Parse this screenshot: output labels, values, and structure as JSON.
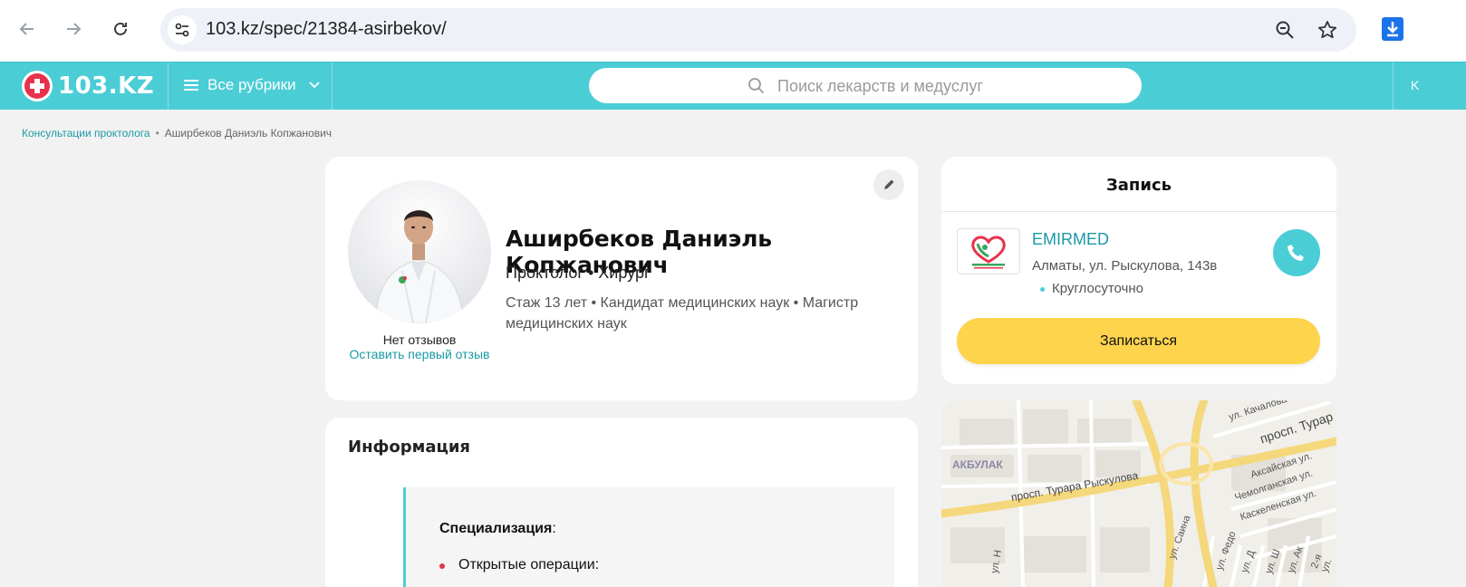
{
  "browser": {
    "url": "103.kz/spec/21384-asirbekov/",
    "icons": [
      "back-arrow-icon",
      "forward-arrow-icon",
      "reload-icon",
      "site-settings-icon",
      "zoom-icon",
      "bookmark-star-icon",
      "download-icon"
    ]
  },
  "header": {
    "logo_text": "103.KZ",
    "rubrics_label": "Все рубрики",
    "search_placeholder": "Поиск лекарств и медуслуг",
    "right_text": "K",
    "accent_color": "#4bcdd6"
  },
  "breadcrumb": {
    "items": [
      "Консультации проктолога",
      "Аширбеков Даниэль Копжанович"
    ],
    "separator": "•"
  },
  "profile": {
    "name": "Аширбеков Даниэль Копжанович",
    "specialties": "Проктолог • Хирург",
    "meta": "Стаж 13 лет  •  Кандидат медицинских наук • Магистр медицинских наук",
    "no_reviews": "Нет отзывов",
    "first_review_link": "Оставить первый отзыв"
  },
  "info": {
    "title": "Информация",
    "specialization_label": "Специализация",
    "specialization_colon": ":",
    "first_item": "Открытые операции:"
  },
  "booking": {
    "title": "Запись",
    "clinic_name": "EMIRMED",
    "clinic_address": "Алматы, ул. Рыскулова, 143в",
    "clinic_hours": "Круглосуточно",
    "book_button": "Записаться",
    "button_color": "#fdd44c"
  },
  "map": {
    "labels": {
      "kachalova": "ул. Качалова",
      "turar": "просп. Турар",
      "akbulak": "АКБУЛАК",
      "aksai": "Аксайская ул.",
      "turar_ryskulova": "просп. Турара Рыскулова",
      "chemolgan": "Чемолганская ул.",
      "kaskelen": "Каскеленская ул.",
      "saina": "ул. Саина",
      "fed": "ул. Федо",
      "ul1": "ул. Н",
      "ul2": "ул. Д",
      "ul3": "ул. Ш",
      "ul4": "ул. Ак",
      "ul5": "2-я ул."
    }
  }
}
